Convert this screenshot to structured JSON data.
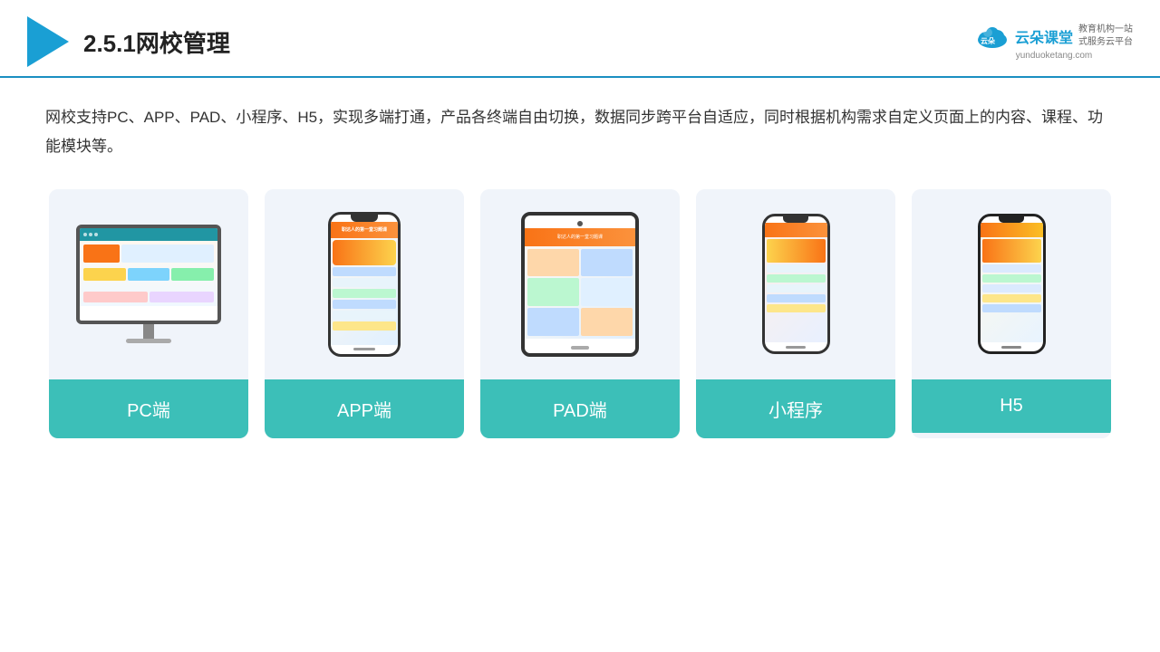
{
  "header": {
    "title": "2.5.1网校管理",
    "brand_name": "云朵课堂",
    "brand_tagline": "教育机构一站\n式服务云平台",
    "brand_url": "yunduoketang.com"
  },
  "main": {
    "description": "网校支持PC、APP、PAD、小程序、H5，实现多端打通，产品各终端自由切换，数据同步跨平台自适应，同时根据机构需求自定义页面上的内容、课程、功能模块等。"
  },
  "cards": [
    {
      "id": "pc",
      "label": "PC端"
    },
    {
      "id": "app",
      "label": "APP端"
    },
    {
      "id": "pad",
      "label": "PAD端"
    },
    {
      "id": "mini",
      "label": "小程序"
    },
    {
      "id": "h5",
      "label": "H5"
    }
  ]
}
